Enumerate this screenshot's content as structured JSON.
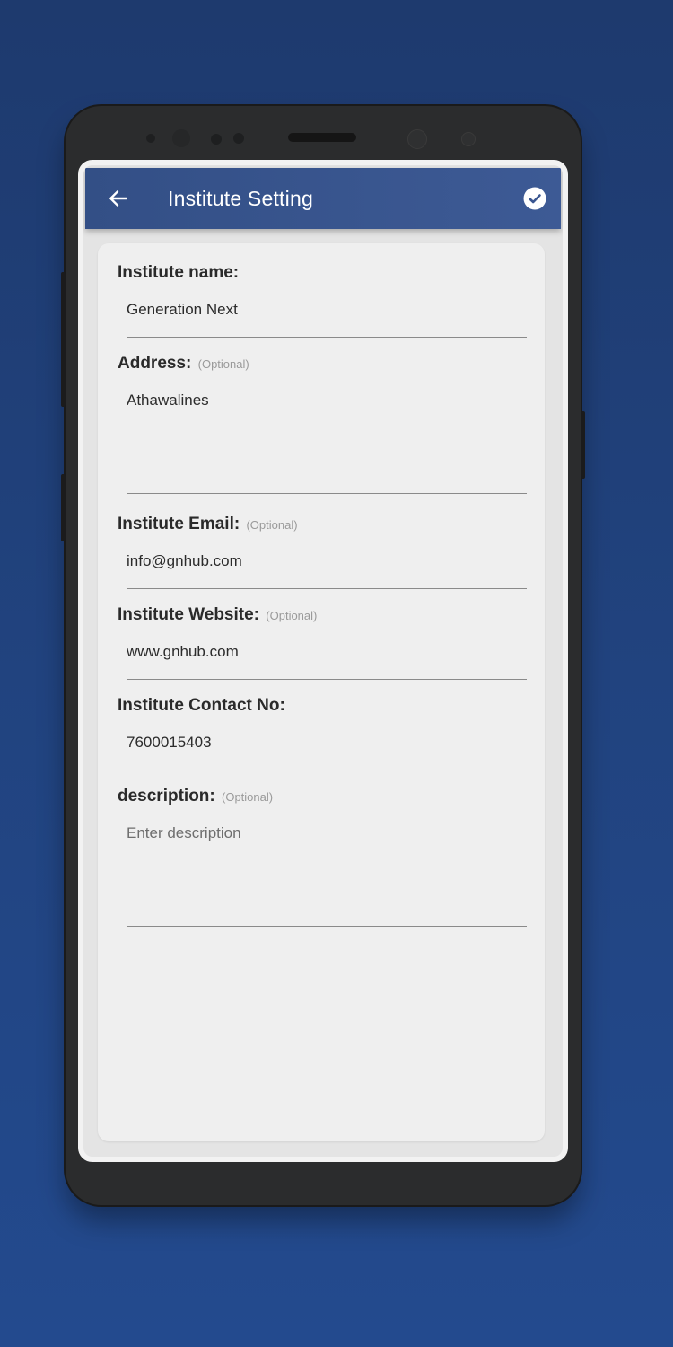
{
  "app_bar": {
    "title": "Institute Setting",
    "back_icon": "arrow-left-icon",
    "save_icon": "check-circle-icon"
  },
  "form": {
    "optional_tag": "(Optional)",
    "fields": [
      {
        "label": "Institute name:",
        "optional": false,
        "value": "Generation Next",
        "placeholder": ""
      },
      {
        "label": "Address:",
        "optional": true,
        "value": "Athawalines",
        "placeholder": ""
      },
      {
        "label": "Institute Email:",
        "optional": true,
        "value": "info@gnhub.com",
        "placeholder": ""
      },
      {
        "label": "Institute Website:",
        "optional": true,
        "value": "www.gnhub.com",
        "placeholder": ""
      },
      {
        "label": "Institute Contact No:",
        "optional": false,
        "value": "7600015403",
        "placeholder": ""
      },
      {
        "label": "description:",
        "optional": true,
        "value": "",
        "placeholder": "Enter description"
      }
    ]
  },
  "colors": {
    "app_bar": "#3a5690",
    "background": "#21437f"
  }
}
